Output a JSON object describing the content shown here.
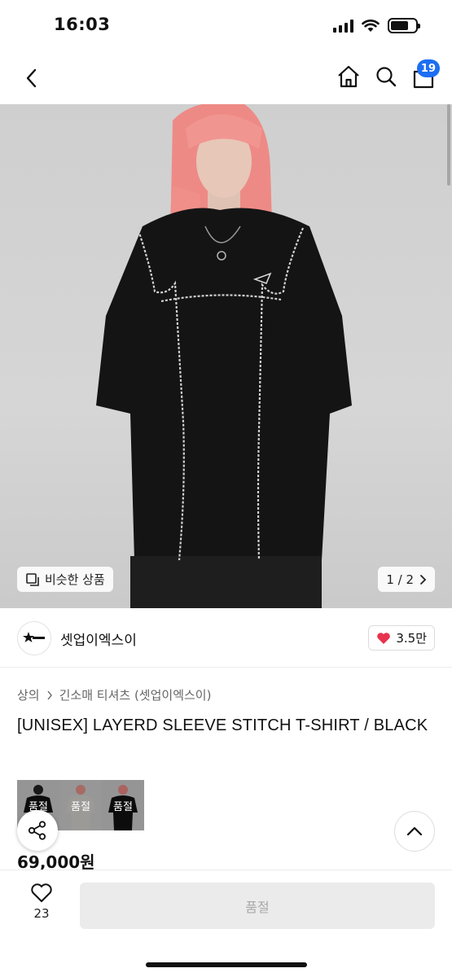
{
  "status_bar": {
    "time": "16:03"
  },
  "nav": {
    "cart_count": "19"
  },
  "gallery": {
    "similar_label": "비슷한 상품",
    "page_counter": "1 / 2"
  },
  "brand": {
    "name": "셋업이엑스이",
    "like_count": "3.5만"
  },
  "breadcrumb": {
    "category": "상의",
    "subcategory": "긴소매 티셔츠 (셋업이엑스이)"
  },
  "product": {
    "title": "[UNISEX] LAYERD SLEEVE STITCH T-SHIRT / BLACK",
    "price": "69,000원"
  },
  "options": [
    {
      "label": "품절",
      "shirt_color": "#111111"
    },
    {
      "label": "품절",
      "shirt_color": "#d9d6d2"
    },
    {
      "label": "품절",
      "shirt_color": "#111111"
    }
  ],
  "bottom_bar": {
    "wish_count": "23",
    "buy_label": "품절"
  },
  "colors": {
    "accent": "#1d6ef2",
    "heart": "#e8344e",
    "disabled_bg": "#ebebeb",
    "disabled_text": "#a8a8a8"
  }
}
